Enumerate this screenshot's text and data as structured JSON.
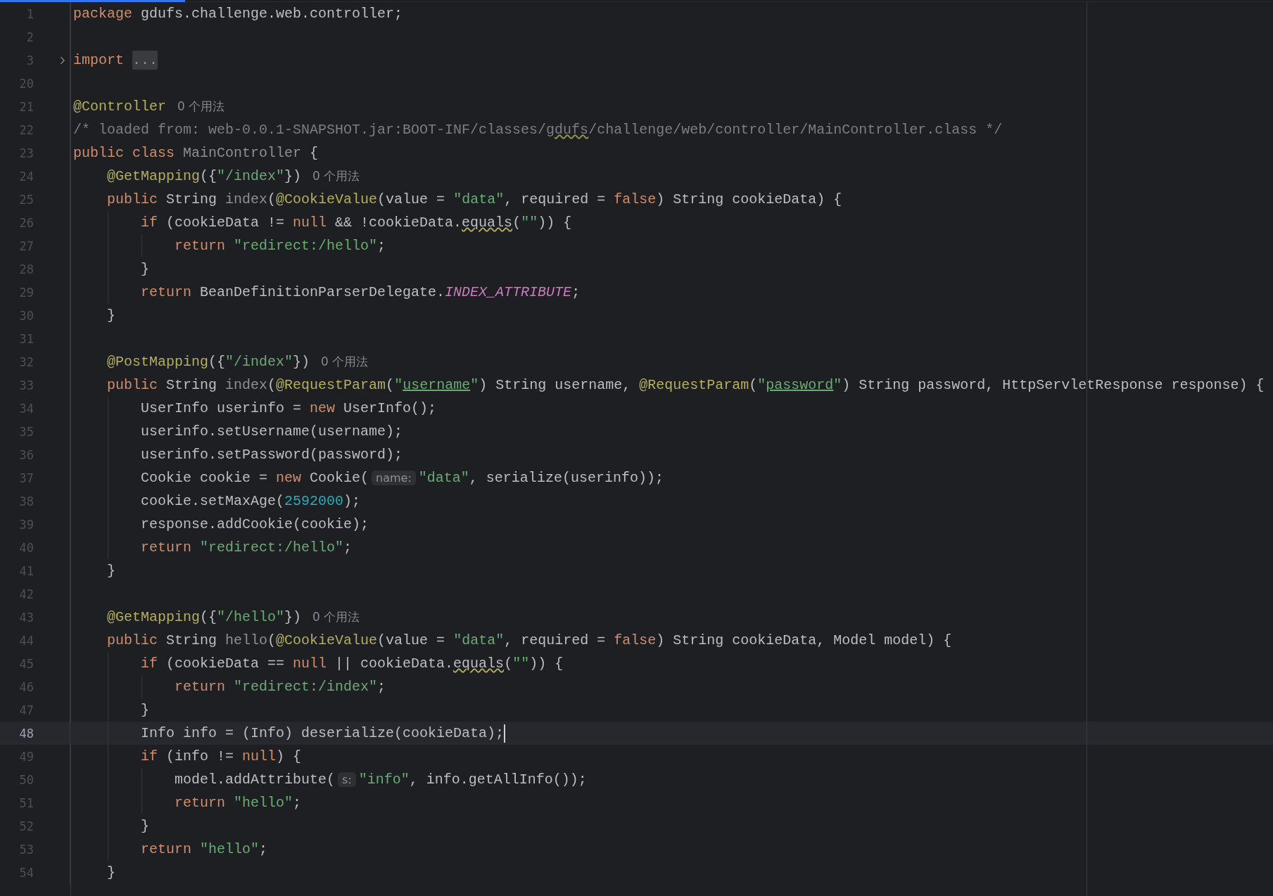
{
  "editor": {
    "lines": [
      {
        "number": "1",
        "kind": "code",
        "selected": false,
        "tokens": [
          {
            "text": "package",
            "kind": "keyword"
          },
          {
            "text": " gdufs.challenge.web.controller;",
            "kind": "plain"
          }
        ]
      },
      {
        "number": "2",
        "kind": "code",
        "selected": false
      },
      {
        "number": "3",
        "kind": "folded",
        "selected": false,
        "tokens": [
          {
            "text": "import ",
            "kind": "keyword"
          },
          {
            "text": "...",
            "kind": "fold-placeholder"
          }
        ]
      },
      {
        "number": "20",
        "kind": "code",
        "selected": false
      },
      {
        "number": "21",
        "kind": "code",
        "selected": false,
        "tokens": [
          {
            "text": "@Controller",
            "kind": "annotation"
          },
          {
            "text": "0 个用法",
            "kind": "usage-hint"
          }
        ]
      },
      {
        "number": "22",
        "kind": "code",
        "selected": false,
        "tokens": [
          {
            "text": "/* loaded from: web-0.0.1-SNAPSHOT.jar:BOOT-INF/classes/",
            "kind": "comment"
          },
          {
            "text": "gdufs",
            "kind": "comment-typo"
          },
          {
            "text": "/challenge/web/controller/MainController.class */",
            "kind": "comment"
          }
        ]
      },
      {
        "number": "23",
        "kind": "code",
        "selected": false,
        "tokens": [
          {
            "text": "public class ",
            "kind": "keyword"
          },
          {
            "text": "MainController",
            "kind": "unused"
          },
          {
            "text": " {",
            "kind": "plain"
          }
        ]
      },
      {
        "number": "24",
        "kind": "code",
        "selected": false,
        "tokens": [
          {
            "text": "    @GetMapping",
            "kind": "annotation"
          },
          {
            "text": "({",
            "kind": "plain"
          },
          {
            "text": "\"/index\"",
            "kind": "string"
          },
          {
            "text": "})",
            "kind": "plain"
          },
          {
            "text": "0 个用法",
            "kind": "usage-hint"
          }
        ]
      },
      {
        "number": "25",
        "kind": "code",
        "selected": false,
        "tokens": [
          {
            "text": "    public",
            "kind": "keyword"
          },
          {
            "text": " String ",
            "kind": "plain"
          },
          {
            "text": "index",
            "kind": "unused"
          },
          {
            "text": "(",
            "kind": "plain"
          },
          {
            "text": "@CookieValue",
            "kind": "annotation"
          },
          {
            "text": "(value = ",
            "kind": "plain"
          },
          {
            "text": "\"data\"",
            "kind": "string"
          },
          {
            "text": ", required = ",
            "kind": "plain"
          },
          {
            "text": "false",
            "kind": "keyword"
          },
          {
            "text": ") String cookieData) {",
            "kind": "plain"
          }
        ]
      },
      {
        "number": "26",
        "kind": "code",
        "selected": false,
        "tokens": [
          {
            "text": "        if",
            "kind": "keyword"
          },
          {
            "text": " (cookieData != ",
            "kind": "plain"
          },
          {
            "text": "null",
            "kind": "keyword"
          },
          {
            "text": " && !cookieData.",
            "kind": "plain"
          },
          {
            "text": "equals",
            "kind": "typo"
          },
          {
            "text": "(",
            "kind": "plain"
          },
          {
            "text": "\"\"",
            "kind": "string"
          },
          {
            "text": ")) {",
            "kind": "plain"
          }
        ]
      },
      {
        "number": "27",
        "kind": "code",
        "selected": false,
        "tokens": [
          {
            "text": "            return ",
            "kind": "keyword"
          },
          {
            "text": "\"redirect:/hello\"",
            "kind": "string"
          },
          {
            "text": ";",
            "kind": "plain"
          }
        ]
      },
      {
        "number": "28",
        "kind": "code",
        "selected": false,
        "tokens": [
          {
            "text": "        }",
            "kind": "plain"
          }
        ]
      },
      {
        "number": "29",
        "kind": "code",
        "selected": false,
        "tokens": [
          {
            "text": "        return",
            "kind": "keyword"
          },
          {
            "text": " BeanDefinitionParserDelegate.",
            "kind": "plain"
          },
          {
            "text": "INDEX_ATTRIBUTE",
            "kind": "static-field"
          },
          {
            "text": ";",
            "kind": "plain"
          }
        ]
      },
      {
        "number": "30",
        "kind": "code",
        "selected": false,
        "tokens": [
          {
            "text": "    }",
            "kind": "plain"
          }
        ]
      },
      {
        "number": "31",
        "kind": "code",
        "selected": false
      },
      {
        "number": "32",
        "kind": "code",
        "selected": false,
        "tokens": [
          {
            "text": "    @PostMapping",
            "kind": "annotation"
          },
          {
            "text": "({",
            "kind": "plain"
          },
          {
            "text": "\"/index\"",
            "kind": "string"
          },
          {
            "text": "})",
            "kind": "plain"
          },
          {
            "text": "0 个用法",
            "kind": "usage-hint"
          }
        ]
      },
      {
        "number": "33",
        "kind": "implementing",
        "selected": false,
        "tokens": [
          {
            "text": "    public",
            "kind": "keyword"
          },
          {
            "text": " String ",
            "kind": "plain"
          },
          {
            "text": "index",
            "kind": "unused"
          },
          {
            "text": "(",
            "kind": "plain"
          },
          {
            "text": "@RequestParam",
            "kind": "annotation"
          },
          {
            "text": "(",
            "kind": "plain"
          },
          {
            "text": "\"",
            "kind": "string"
          },
          {
            "text": "username",
            "kind": "string-ref"
          },
          {
            "text": "\"",
            "kind": "string"
          },
          {
            "text": ") String username, ",
            "kind": "plain"
          },
          {
            "text": "@RequestParam",
            "kind": "annotation"
          },
          {
            "text": "(",
            "kind": "plain"
          },
          {
            "text": "\"",
            "kind": "string"
          },
          {
            "text": "password",
            "kind": "string-ref"
          },
          {
            "text": "\"",
            "kind": "string"
          },
          {
            "text": ") String password, HttpServletResponse response) {",
            "kind": "plain"
          }
        ]
      },
      {
        "number": "34",
        "kind": "code",
        "selected": false,
        "tokens": [
          {
            "text": "        UserInfo userinfo = ",
            "kind": "plain"
          },
          {
            "text": "new",
            "kind": "keyword"
          },
          {
            "text": " UserInfo();",
            "kind": "plain"
          }
        ]
      },
      {
        "number": "35",
        "kind": "code",
        "selected": false,
        "tokens": [
          {
            "text": "        userinfo.setUsername(username);",
            "kind": "plain"
          }
        ]
      },
      {
        "number": "36",
        "kind": "code",
        "selected": false,
        "tokens": [
          {
            "text": "        userinfo.setPassword(password);",
            "kind": "plain"
          }
        ]
      },
      {
        "number": "37",
        "kind": "code",
        "selected": false,
        "tokens": [
          {
            "text": "        Cookie cookie = ",
            "kind": "plain"
          },
          {
            "text": "new",
            "kind": "keyword"
          },
          {
            "text": " Cookie(",
            "kind": "plain"
          },
          {
            "text": "name:",
            "kind": "param-hint"
          },
          {
            "text": "\"data\"",
            "kind": "string"
          },
          {
            "text": ", serialize(userinfo));",
            "kind": "plain"
          }
        ]
      },
      {
        "number": "38",
        "kind": "code",
        "selected": false,
        "tokens": [
          {
            "text": "        cookie.setMaxAge(",
            "kind": "plain"
          },
          {
            "text": "2592000",
            "kind": "number"
          },
          {
            "text": ");",
            "kind": "plain"
          }
        ]
      },
      {
        "number": "39",
        "kind": "code",
        "selected": false,
        "tokens": [
          {
            "text": "        response.addCookie(cookie);",
            "kind": "plain"
          }
        ]
      },
      {
        "number": "40",
        "kind": "code",
        "selected": false,
        "tokens": [
          {
            "text": "        return ",
            "kind": "keyword"
          },
          {
            "text": "\"redirect:/hello\"",
            "kind": "string"
          },
          {
            "text": ";",
            "kind": "plain"
          }
        ]
      },
      {
        "number": "41",
        "kind": "code",
        "selected": false,
        "tokens": [
          {
            "text": "    }",
            "kind": "plain"
          }
        ]
      },
      {
        "number": "42",
        "kind": "code",
        "selected": false
      },
      {
        "number": "43",
        "kind": "code",
        "selected": false,
        "tokens": [
          {
            "text": "    @GetMapping",
            "kind": "annotation"
          },
          {
            "text": "({",
            "kind": "plain"
          },
          {
            "text": "\"/hello\"",
            "kind": "string"
          },
          {
            "text": "})",
            "kind": "plain"
          },
          {
            "text": "0 个用法",
            "kind": "usage-hint"
          }
        ]
      },
      {
        "number": "44",
        "kind": "code",
        "selected": false,
        "tokens": [
          {
            "text": "    public",
            "kind": "keyword"
          },
          {
            "text": " String ",
            "kind": "plain"
          },
          {
            "text": "hello",
            "kind": "unused"
          },
          {
            "text": "(",
            "kind": "plain"
          },
          {
            "text": "@CookieValue",
            "kind": "annotation"
          },
          {
            "text": "(value = ",
            "kind": "plain"
          },
          {
            "text": "\"data\"",
            "kind": "string"
          },
          {
            "text": ", required = ",
            "kind": "plain"
          },
          {
            "text": "false",
            "kind": "keyword"
          },
          {
            "text": ") String cookieData, Model model) {",
            "kind": "plain"
          }
        ]
      },
      {
        "number": "45",
        "kind": "code",
        "selected": false,
        "tokens": [
          {
            "text": "        if",
            "kind": "keyword"
          },
          {
            "text": " (cookieData == ",
            "kind": "plain"
          },
          {
            "text": "null",
            "kind": "keyword"
          },
          {
            "text": " || cookieData.",
            "kind": "plain"
          },
          {
            "text": "equals",
            "kind": "typo"
          },
          {
            "text": "(",
            "kind": "plain"
          },
          {
            "text": "\"\"",
            "kind": "string"
          },
          {
            "text": ")) {",
            "kind": "plain"
          }
        ]
      },
      {
        "number": "46",
        "kind": "code",
        "selected": false,
        "tokens": [
          {
            "text": "            return ",
            "kind": "keyword"
          },
          {
            "text": "\"redirect:/index\"",
            "kind": "string"
          },
          {
            "text": ";",
            "kind": "plain"
          }
        ]
      },
      {
        "number": "47",
        "kind": "code",
        "selected": false,
        "tokens": [
          {
            "text": "        }",
            "kind": "plain"
          }
        ]
      },
      {
        "number": "48",
        "kind": "code",
        "selected": true,
        "tokens": [
          {
            "text": "        Info info = (Info) deserialize(cookieData);",
            "kind": "plain"
          }
        ]
      },
      {
        "number": "49",
        "kind": "code",
        "selected": false,
        "tokens": [
          {
            "text": "        if",
            "kind": "keyword"
          },
          {
            "text": " (info != ",
            "kind": "plain"
          },
          {
            "text": "null",
            "kind": "keyword"
          },
          {
            "text": ") {",
            "kind": "plain"
          }
        ]
      },
      {
        "number": "50",
        "kind": "code",
        "selected": false,
        "tokens": [
          {
            "text": "            model.addAttribute(",
            "kind": "plain"
          },
          {
            "text": "s:",
            "kind": "param-hint"
          },
          {
            "text": "\"info\"",
            "kind": "string"
          },
          {
            "text": ", info.getAllInfo());",
            "kind": "plain"
          }
        ]
      },
      {
        "number": "51",
        "kind": "code",
        "selected": false,
        "tokens": [
          {
            "text": "            return ",
            "kind": "keyword"
          },
          {
            "text": "\"hello\"",
            "kind": "string"
          },
          {
            "text": ";",
            "kind": "plain"
          }
        ]
      },
      {
        "number": "52",
        "kind": "code",
        "selected": false,
        "tokens": [
          {
            "text": "        }",
            "kind": "plain"
          }
        ]
      },
      {
        "number": "53",
        "kind": "code",
        "selected": false,
        "tokens": [
          {
            "text": "        return ",
            "kind": "keyword"
          },
          {
            "text": "\"hello\"",
            "kind": "string"
          },
          {
            "text": ";",
            "kind": "plain"
          }
        ]
      },
      {
        "number": "54",
        "kind": "code",
        "selected": false,
        "tokens": [
          {
            "text": "    }",
            "kind": "plain"
          }
        ]
      }
    ]
  }
}
